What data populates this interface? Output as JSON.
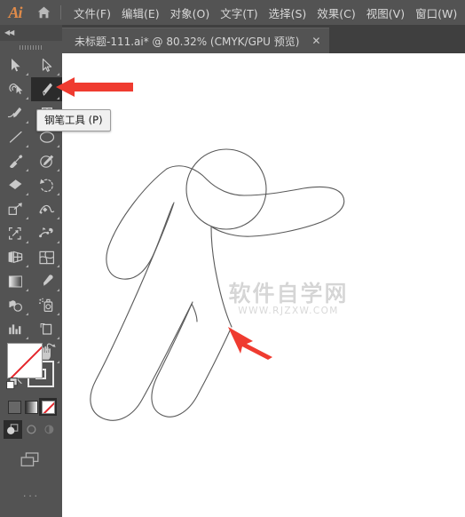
{
  "app": {
    "logo_text": "Ai",
    "home_icon": "home-icon"
  },
  "menubar": {
    "items": [
      {
        "label": "文件(F)"
      },
      {
        "label": "编辑(E)"
      },
      {
        "label": "对象(O)"
      },
      {
        "label": "文字(T)"
      },
      {
        "label": "选择(S)"
      },
      {
        "label": "效果(C)"
      },
      {
        "label": "视图(V)"
      },
      {
        "label": "窗口(W)"
      }
    ]
  },
  "tabbar": {
    "collapse_chevrons": "◀◀",
    "document_tab": {
      "title": "未标题-111.ai* @ 80.32% (CMYK/GPU 预览)",
      "close": "✕"
    }
  },
  "toolbar": {
    "tools": [
      {
        "name": "selection-tool",
        "label": "选择工具"
      },
      {
        "name": "direct-selection-tool",
        "label": "直接选择工具"
      },
      {
        "name": "magic-wand-tool",
        "label": "魔棒工具"
      },
      {
        "name": "pen-tool",
        "label": "钢笔工具",
        "selected": true
      },
      {
        "name": "curvature-tool",
        "label": "曲率工具"
      },
      {
        "name": "type-tool",
        "label": "文字工具"
      },
      {
        "name": "line-segment-tool",
        "label": "直线段工具"
      },
      {
        "name": "ellipse-tool",
        "label": "椭圆工具"
      },
      {
        "name": "paintbrush-tool",
        "label": "画笔工具"
      },
      {
        "name": "shaper-tool",
        "label": "Shaper 工具"
      },
      {
        "name": "eraser-tool",
        "label": "橡皮擦工具"
      },
      {
        "name": "rotate-tool",
        "label": "旋转工具"
      },
      {
        "name": "scale-tool",
        "label": "比例缩放工具"
      },
      {
        "name": "width-tool",
        "label": "宽度工具"
      },
      {
        "name": "free-transform-tool",
        "label": "自由变换工具"
      },
      {
        "name": "shape-builder-tool",
        "label": "形状生成器工具"
      },
      {
        "name": "perspective-grid-tool",
        "label": "透视网格工具"
      },
      {
        "name": "mesh-tool",
        "label": "网格工具"
      },
      {
        "name": "gradient-tool",
        "label": "渐变工具"
      },
      {
        "name": "eyedropper-tool",
        "label": "吸管工具"
      },
      {
        "name": "blend-tool",
        "label": "混合工具"
      },
      {
        "name": "symbol-sprayer-tool",
        "label": "符号喷枪工具"
      },
      {
        "name": "column-graph-tool",
        "label": "柱形图工具"
      },
      {
        "name": "artboard-tool",
        "label": "画板工具"
      },
      {
        "name": "slice-tool",
        "label": "切片工具"
      },
      {
        "name": "hand-tool",
        "label": "抓手工具"
      },
      {
        "name": "zoom-tool",
        "label": "缩放工具"
      }
    ],
    "color_controls": {
      "fill_label": "填色",
      "stroke_label": "描边",
      "swap_label": "互换填色和描边",
      "default_label": "默认填色和描边"
    },
    "fill_modes": [
      {
        "name": "color-mode",
        "label": "颜色"
      },
      {
        "name": "gradient-mode",
        "label": "渐变"
      },
      {
        "name": "none-mode",
        "label": "无",
        "active": true
      }
    ],
    "draw_modes": [
      {
        "name": "draw-normal",
        "label": "正常绘图",
        "active": true
      },
      {
        "name": "draw-behind",
        "label": "背面绘图",
        "active": false
      },
      {
        "name": "draw-inside",
        "label": "内部绘图",
        "active": false
      }
    ],
    "screen_mode": {
      "name": "change-screen-mode",
      "label": "更改屏幕模式"
    },
    "more_tools": {
      "name": "edit-toolbar",
      "label": "···"
    }
  },
  "tooltip": {
    "text": "钢笔工具 (P)"
  },
  "canvas": {
    "watermark_cn": "软件自学网",
    "watermark_en": "WWW.RJZXW.COM",
    "artwork_description": "人物轮廓线稿",
    "annotations": [
      {
        "name": "arrow-to-pen-tool",
        "color": "#ef3b30"
      },
      {
        "name": "arrow-to-body-path",
        "color": "#ef3b30"
      }
    ]
  },
  "colors": {
    "chrome": "#535353",
    "tabbar": "#3f3f3f",
    "canvas": "#ffffff",
    "accent_red": "#ef3b30",
    "logo_orange": "#e08b4a",
    "stroke_gray": "#5a5a5a"
  }
}
